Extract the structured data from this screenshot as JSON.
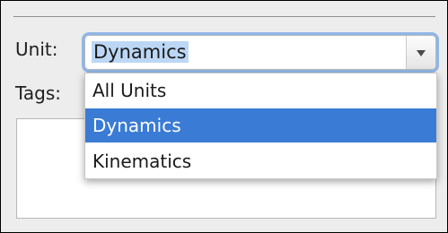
{
  "form": {
    "unit_label": "Unit:",
    "tags_label": "Tags:",
    "unit_select": {
      "value": "Dynamics",
      "selected_index": 1
    },
    "unit_options": [
      "All Units",
      "Dynamics",
      "Kinematics"
    ],
    "tags_value": ""
  },
  "colors": {
    "selection_highlight": "#3a7bd5",
    "focus_ring": "#8fb7e8"
  }
}
